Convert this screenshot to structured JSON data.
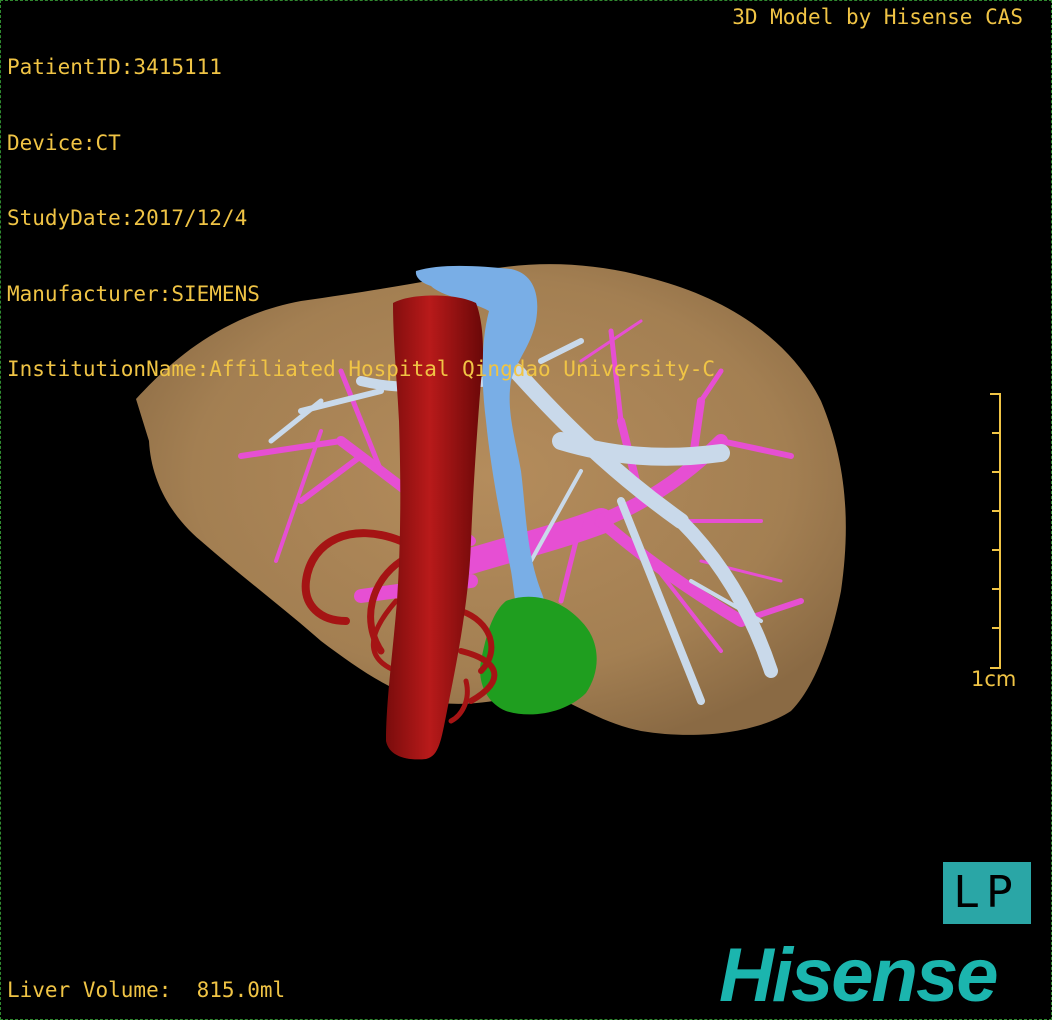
{
  "overlay": {
    "patient_id": "PatientID:3415111",
    "device": "Device:CT",
    "study_date": "StudyDate:2017/12/4",
    "manufacturer": "Manufacturer:SIEMENS",
    "institution": "InstitutionName:Affiliated Hospital Qingdao University-C",
    "credit": "3D Model by Hisense CAS",
    "liver_volume": "Liver Volume:  815.0ml",
    "scale_label": "1cm",
    "orientation": "LP",
    "brand": "Hisense"
  },
  "colors": {
    "overlay_text": "#f0c445",
    "liver": "#a88456",
    "portal_vein": "#e64fd3",
    "hepatic_vein": "#c8d8ea",
    "ivc": "#79aee6",
    "aorta": "#a51414",
    "tumor": "#1f9e1f",
    "brand": "#1bb5ae"
  }
}
